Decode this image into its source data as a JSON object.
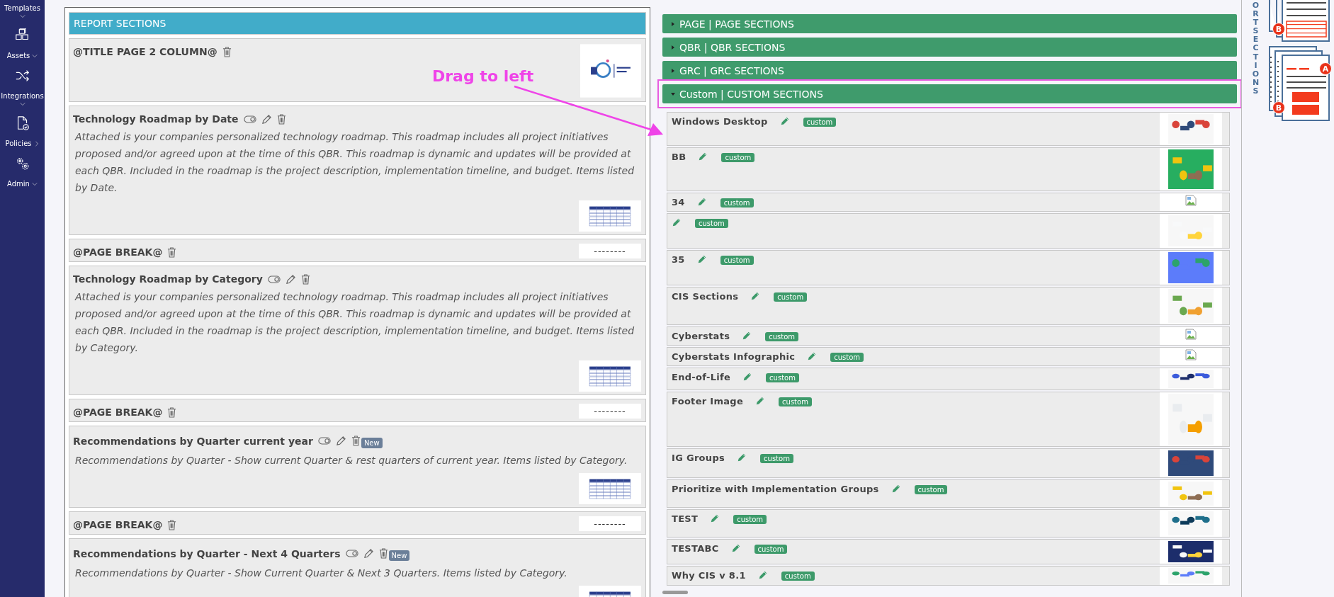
{
  "sidebar": {
    "items": [
      {
        "label": "Templates",
        "kind": "dropdown"
      },
      {
        "label": "Assets",
        "kind": "dropdown"
      },
      {
        "label": "Integrations",
        "kind": "dropdown"
      },
      {
        "label": "Policies",
        "kind": "submenu"
      },
      {
        "label": "Admin",
        "kind": "dropdown"
      }
    ]
  },
  "report_sections": {
    "title": "REPORT SECTIONS",
    "cards": [
      {
        "kind": "title",
        "heading": "@TITLE PAGE 2 COLUMN@"
      },
      {
        "kind": "section",
        "heading": "Technology Roadmap by Date",
        "description": "Attached is your companies personalized technology roadmap. This roadmap includes all project initiatives proposed and/or agreed upon at the time of this QBR. This roadmap is dynamic and updates will be provided at each QBR. Included in the roadmap is the project description, implementation timeline, and budget. Items listed by Date."
      },
      {
        "kind": "pagebreak",
        "heading": "@PAGE BREAK@",
        "marker": "--------"
      },
      {
        "kind": "section",
        "heading": "Technology Roadmap by Category",
        "description": "Attached is your companies personalized technology roadmap. This roadmap includes all project initiatives proposed and/or agreed upon at the time of this QBR. This roadmap is dynamic and updates will be provided at each QBR. Included in the roadmap is the project description, implementation timeline, and budget. Items listed by Category."
      },
      {
        "kind": "pagebreak",
        "heading": "@PAGE BREAK@",
        "marker": "--------"
      },
      {
        "kind": "section",
        "heading": "Recommendations by Quarter current year",
        "badge": "New",
        "description": "Recommendations by Quarter - Show current Quarter & rest quarters of current year. Items listed by Category."
      },
      {
        "kind": "pagebreak",
        "heading": "@PAGE BREAK@",
        "marker": "--------"
      },
      {
        "kind": "section",
        "heading": "Recommendations by Quarter - Next 4 Quarters",
        "badge": "New",
        "description": "Recommendations by Quarter - Show Current Quarter & Next 3 Quarters. Items listed by Category."
      }
    ]
  },
  "annotation": {
    "text": "Drag to left"
  },
  "library": {
    "groups": [
      {
        "label": "PAGE | PAGE SECTIONS",
        "expanded": false,
        "highlighted": false
      },
      {
        "label": "QBR | QBR SECTIONS",
        "expanded": false,
        "highlighted": false
      },
      {
        "label": "GRC | GRC SECTIONS",
        "expanded": false,
        "highlighted": false
      },
      {
        "label": "Custom | CUSTOM SECTIONS",
        "expanded": true,
        "highlighted": true
      }
    ],
    "items": [
      {
        "name": "Windows Desktop",
        "tag": "custom",
        "kind": "picture"
      },
      {
        "name": "BB",
        "tag": "custom",
        "kind": "picture"
      },
      {
        "name": "34",
        "tag": "custom",
        "kind": "broken"
      },
      {
        "tag": "custom",
        "kind": "picture"
      },
      {
        "name": "35",
        "tag": "custom",
        "kind": "picture"
      },
      {
        "name": "CIS Sections",
        "tag": "custom",
        "kind": "picture"
      },
      {
        "name": "Cyberstats",
        "tag": "custom",
        "kind": "broken"
      },
      {
        "name": "Cyberstats Infographic",
        "tag": "custom",
        "kind": "broken"
      },
      {
        "name": "End-of-Life",
        "tag": "custom",
        "kind": "picture"
      },
      {
        "name": "Footer Image",
        "tag": "custom",
        "kind": "picture"
      },
      {
        "name": "IG Groups",
        "tag": "custom",
        "kind": "picture"
      },
      {
        "name": "Prioritize with Implementation Groups",
        "tag": "custom",
        "kind": "picture"
      },
      {
        "name": "TEST",
        "tag": "custom",
        "kind": "picture"
      },
      {
        "name": "TESTABC",
        "tag": "custom",
        "kind": "picture"
      },
      {
        "name": "Why CIS v 8.1",
        "tag": "custom",
        "kind": "picture"
      }
    ]
  },
  "diagram": {
    "label": "ORT SECTIONS",
    "badges": [
      "B",
      "A",
      "B"
    ]
  }
}
